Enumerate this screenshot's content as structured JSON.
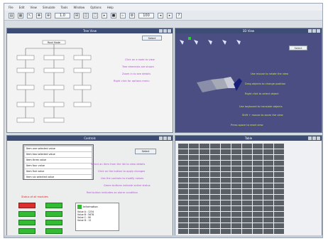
{
  "menu": [
    "File",
    "Edit",
    "View",
    "Simulate",
    "Tools",
    "Window",
    "Options",
    "Help"
  ],
  "toolbar": {
    "combo1": "1.0",
    "combo2": "100"
  },
  "pane1": {
    "title": "Tree View",
    "root": "Root Node",
    "button": "Select",
    "purple_lines": [
      "Click on a node to view",
      "Tree elements are shown",
      "Zoom in to see details",
      "Right click for options menu"
    ]
  },
  "pane2": {
    "title": "3D View",
    "label": "",
    "button": "Select",
    "yellow_lines": [
      "Use mouse to rotate the view",
      "Drag objects to change position",
      "Right click to select object",
      "Use keyboard to translate objects",
      "Shift + mouse to zoom the view",
      "Press space to reset view"
    ]
  },
  "pane3": {
    "title": "Controls",
    "button": "Select",
    "list": [
      "Item one selected value",
      "Item two selected value",
      "Item three value",
      "Item four value",
      "Item five value",
      "Item six selected value"
    ],
    "purple_lines": [
      "Select an item from the list to view details",
      "Click on the button to apply changes",
      "Use the controls to modify values",
      "Green buttons indicate active status",
      "Red button indicates an alarm condition"
    ],
    "status_label": "Status of all modules",
    "info_title": "Information",
    "info_lines": [
      "Value A : 1234",
      "Value B : 5678",
      "Value C : 90",
      "Value D : 12"
    ]
  },
  "pane4": {
    "title": "Table"
  },
  "colors": {
    "titlebar": "#3d4c74",
    "purple": "#b14dd8",
    "yellow": "#d6e44a",
    "green": "#33bb33",
    "red": "#dd2e2e"
  }
}
